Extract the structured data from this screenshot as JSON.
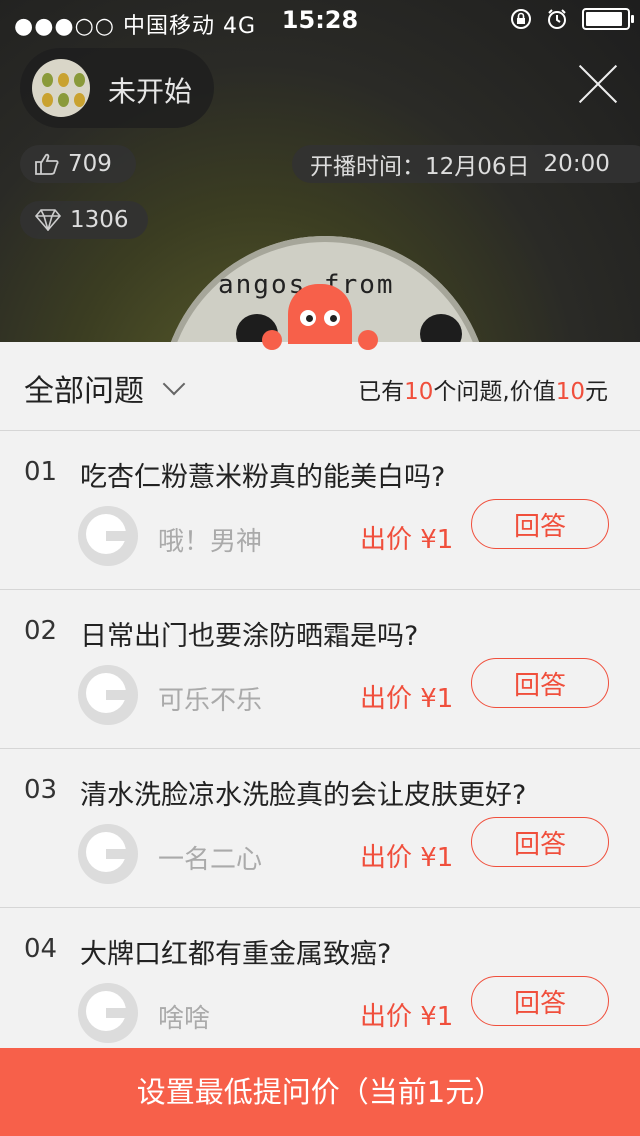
{
  "status_bar": {
    "carrier": "●●●○○ 中国移动  4G",
    "time": "15:28"
  },
  "host": {
    "status": "未开始"
  },
  "stats": {
    "likes": "709",
    "diamonds": "1306"
  },
  "schedule": {
    "label": "开播时间：",
    "date": "12月06日",
    "time": "20:00"
  },
  "cover": {
    "text": "angos from"
  },
  "list_header": {
    "filter_label": "全部问题",
    "summary_prefix": "已有",
    "question_count": "10",
    "summary_middle": "个问题,价值",
    "total_value": "10",
    "summary_suffix": "元"
  },
  "questions": [
    {
      "num": "01",
      "text": "吃杏仁粉薏米粉真的能美白吗?",
      "asker": "哦！男神",
      "price": "出价 ¥1",
      "answer_label": "回答"
    },
    {
      "num": "02",
      "text": "日常出门也要涂防晒霜是吗?",
      "asker": "可乐不乐",
      "price": "出价 ¥1",
      "answer_label": "回答"
    },
    {
      "num": "03",
      "text": "清水洗脸凉水洗脸真的会让皮肤更好?",
      "asker": "一名二心",
      "price": "出价 ¥1",
      "answer_label": "回答"
    },
    {
      "num": "04",
      "text": "大牌口红都有重金属致癌?",
      "asker": "啥啥",
      "price": "出价 ¥1",
      "answer_label": "回答"
    }
  ],
  "bottom_button": {
    "label": "设置最低提问价（当前1元）"
  },
  "colors": {
    "accent": "#f7604a",
    "price_red": "#f04f3c",
    "panel_bg": "#f2f2f2"
  }
}
